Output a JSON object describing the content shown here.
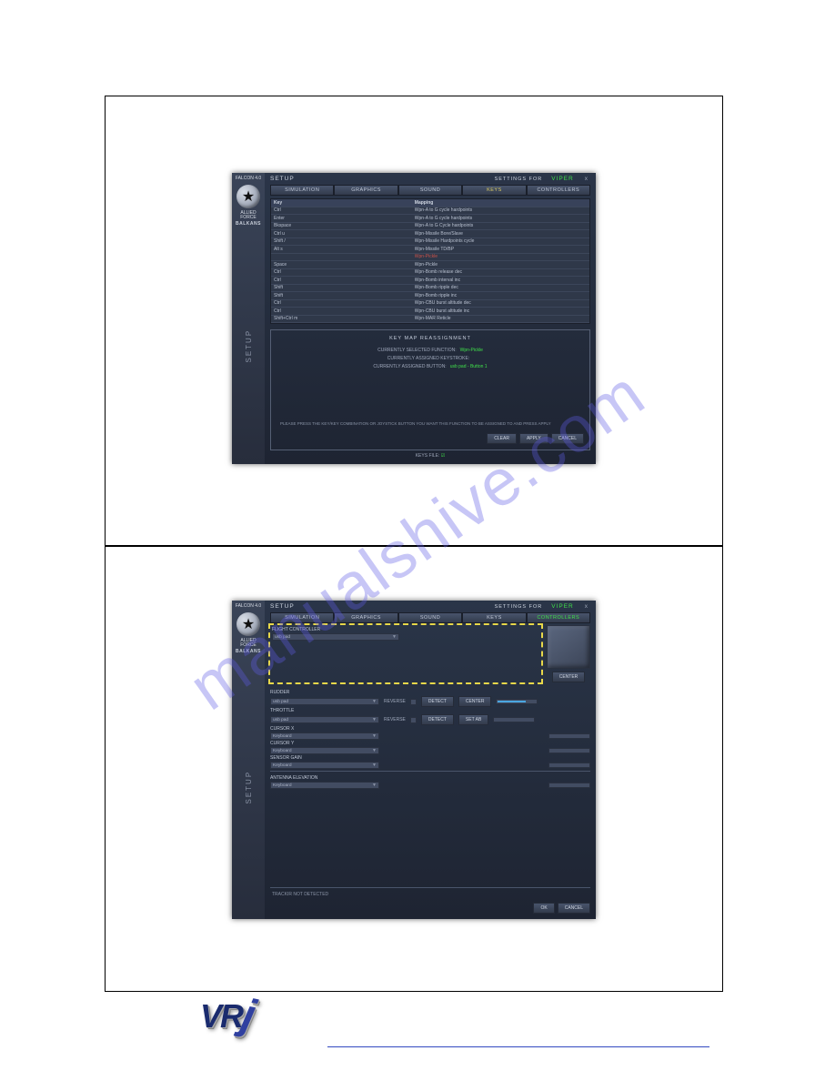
{
  "watermark": "manualshive.com",
  "sidebar": {
    "title": "FALCON 4.0",
    "subtitle": "ALLIED FORCE",
    "theater": "BALKANS",
    "side_label": "SETUP"
  },
  "top": {
    "setup_title": "SETUP",
    "settings_for": "SETTINGS FOR",
    "callsign": "VIPER",
    "close": "x",
    "tabs": [
      "Simulation",
      "Graphics",
      "Sound",
      "Keys",
      "Controllers"
    ],
    "col_key": "Key",
    "col_map": "Mapping",
    "rows": [
      {
        "k": "Ctrl ",
        "m": "Wpn-A to G cycle hardpoints"
      },
      {
        "k": "Enter",
        "m": "Wpn-A to G cycle hardpoints"
      },
      {
        "k": "Bkspace",
        "m": "Wpn-A to G Cycle hardpoints"
      },
      {
        "k": "Ctrl u",
        "m": "Wpn-Missile Bore/Slave"
      },
      {
        "k": "Shift /",
        "m": "Wpn-Missile Hardpoints cycle"
      },
      {
        "k": "Alt s",
        "m": "Wpn-Missile TD/BP"
      },
      {
        "k": "",
        "m": "Wpn-Pickle",
        "sel": true
      },
      {
        "k": "Space",
        "m": "Wpn-Pickle"
      },
      {
        "k": "Ctrl",
        "m": "Wpn-Bomb release dec"
      },
      {
        "k": "Ctrl",
        "m": "Wpn-Bomb interval inc"
      },
      {
        "k": "Shift",
        "m": "Wpn-Bomb ripple dec"
      },
      {
        "k": "Shift",
        "m": "Wpn-Bomb ripple inc"
      },
      {
        "k": "Ctrl",
        "m": "Wpn-CBU burst altitude dec"
      },
      {
        "k": "Ctrl",
        "m": "Wpn-CBU burst altitude inc"
      },
      {
        "k": "Shift+Ctrl m",
        "m": "Wpn-MAR Reticle"
      }
    ],
    "panel_title": "Key Map Reassignment",
    "func_label": "Currently selected function:",
    "func_val": "Wpn-Pickle",
    "keystroke_label": "Currently assigned keystroke:",
    "keystroke_val": "",
    "button_label": "Currently assigned button:",
    "button_val": "usb pad - Button 1",
    "instructions": "Please press the key/key combination or joystick button you want this function to be assigned to and press Apply",
    "buttons": [
      "Clear",
      "Apply",
      "Cancel"
    ],
    "keys_file": "Keys file:"
  },
  "bot": {
    "flight_controller": "Flight Controller",
    "fc_value": "usb pad",
    "center": "Center",
    "rudder": "Rudder",
    "rudder_val": "usb pad",
    "reverse": "Reverse",
    "detect": "Detect",
    "throttle": "Throttle",
    "throttle_val": "usb pad",
    "set_ab": "Set AB",
    "cursor_x": "Cursor X",
    "cursor_x_val": "Keyboard",
    "cursor_y": "Cursor Y",
    "cursor_y_val": "Keyboard",
    "sensor_gain": "Sensor Gain",
    "sensor_gain_val": "Keyboard",
    "antenna": "Antenna Elevation",
    "antenna_val": "Keyboard",
    "trackir": "TrackIR not detected",
    "ok": "Ok",
    "cancel": "Cancel"
  },
  "logo": "VR"
}
